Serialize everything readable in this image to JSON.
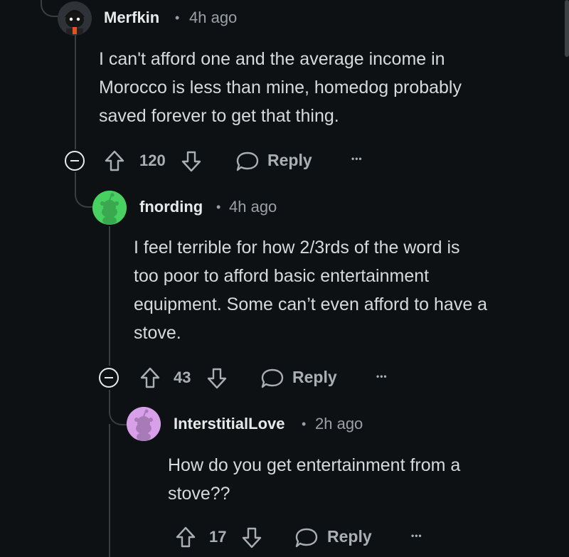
{
  "comments": [
    {
      "username": "Merfkin",
      "separator": "•",
      "time": "4h ago",
      "body_lines": [
        "I can't afford one and the average income in",
        "Morocco is less than mine, homedog probably",
        "saved forever to get that thing."
      ],
      "votes": "120",
      "reply_label": "Reply",
      "more_label": "•••"
    },
    {
      "username": "fnording",
      "separator": "•",
      "time": "4h ago",
      "body_lines": [
        "I feel terrible for how 2/3rds of the word is",
        "too poor to afford basic entertainment",
        "equipment. Some can’t even afford to have a",
        "stove."
      ],
      "votes": "43",
      "reply_label": "Reply",
      "more_label": "•••"
    },
    {
      "username": "InterstitialLove",
      "separator": "•",
      "time": "2h ago",
      "body_lines": [
        "How do you get entertainment from a",
        "stove??"
      ],
      "votes": "17",
      "reply_label": "Reply",
      "more_label": "•••"
    }
  ],
  "colors": {
    "background": "#0e1113",
    "avatar_green": "#46d160",
    "avatar_pink": "#d8a0e8"
  }
}
